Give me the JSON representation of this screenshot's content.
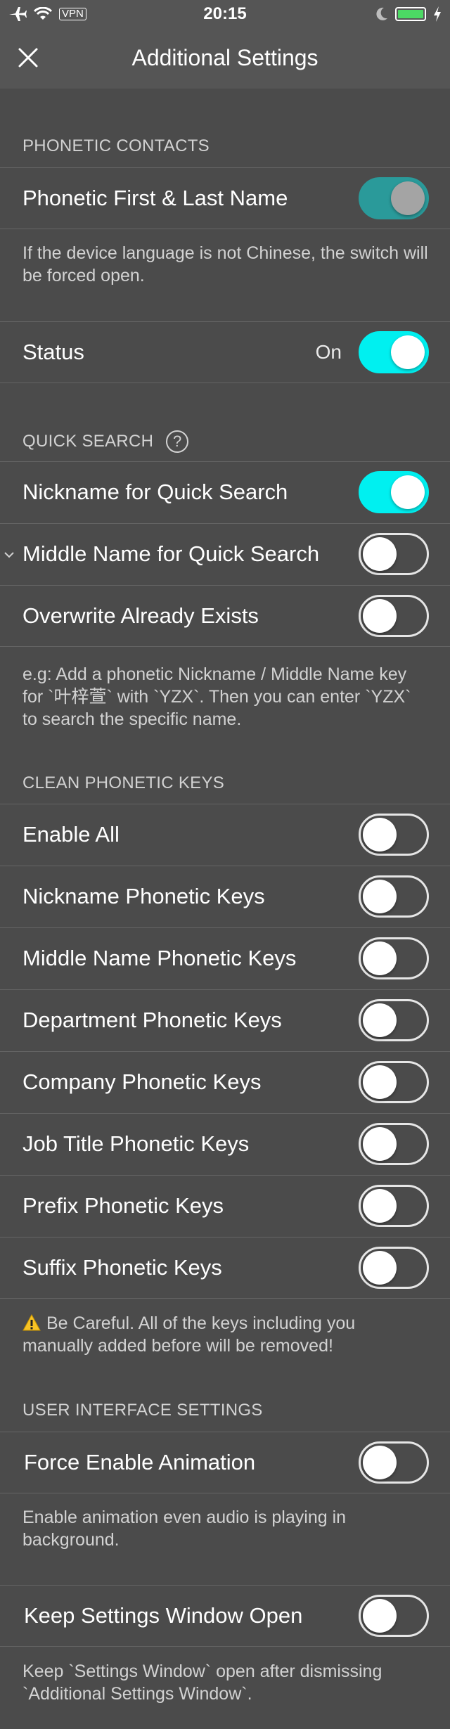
{
  "status_bar": {
    "vpn": "VPN",
    "time": "20:15",
    "icons": [
      "airplane-icon",
      "wifi-icon",
      "moon-icon",
      "battery-icon",
      "charging-icon"
    ],
    "battery_color": "#4cd964"
  },
  "nav": {
    "title": "Additional Settings",
    "close_icon": "close-icon"
  },
  "colors": {
    "toggle_on": "#00f0f0",
    "toggle_on_disabled": "#2a9a9a",
    "background": "#4b4b4b",
    "header_text": "#d2d2d2"
  },
  "phonetic_contacts": {
    "header": "PHONETIC CONTACTS",
    "first_last": {
      "label": "Phonetic First & Last Name",
      "on": true,
      "disabled": true
    },
    "note": "If the device language is not Chinese, the switch will be forced open.",
    "status": {
      "label": "Status",
      "value": "On",
      "on": true
    }
  },
  "quick_search": {
    "header": "QUICK SEARCH",
    "help_icon": "question-circle-icon",
    "help_glyph": "?",
    "rows": [
      {
        "label": "Nickname for Quick Search",
        "on": true
      },
      {
        "label": "Middle Name for Quick Search",
        "on": false,
        "chevron": "chevron-down-icon"
      },
      {
        "label": "Overwrite Already  Exists",
        "on": false
      }
    ],
    "note": "e.g: Add a phonetic Nickname / Middle Name key for `叶梓萱` with `YZX`. Then you can enter `YZX` to search the specific name."
  },
  "clean_keys": {
    "header": "CLEAN PHONETIC KEYS",
    "rows": [
      {
        "label": "Enable All",
        "on": false
      },
      {
        "label": "Nickname Phonetic Keys",
        "on": false
      },
      {
        "label": "Middle Name Phonetic Keys",
        "on": false
      },
      {
        "label": "Department Phonetic Keys",
        "on": false
      },
      {
        "label": "Company Phonetic Keys",
        "on": false
      },
      {
        "label": "Job Title Phonetic Keys",
        "on": false
      },
      {
        "label": "Prefix Phonetic Keys",
        "on": false
      },
      {
        "label": "Suffix Phonetic Keys",
        "on": false
      }
    ],
    "warning_icon": "warning-icon",
    "warning": "Be Careful. All of the keys including you manually added before will be removed!"
  },
  "ui_settings": {
    "header": "USER INTERFACE SETTINGS",
    "force_animation": {
      "label": "Force Enable Animation",
      "on": false
    },
    "force_animation_note": "Enable animation even audio is playing in background.",
    "keep_open": {
      "label": "Keep Settings Window Open",
      "on": false
    },
    "keep_open_note": "Keep `Settings Window` open after dismissing `Additional Settings Window`."
  }
}
